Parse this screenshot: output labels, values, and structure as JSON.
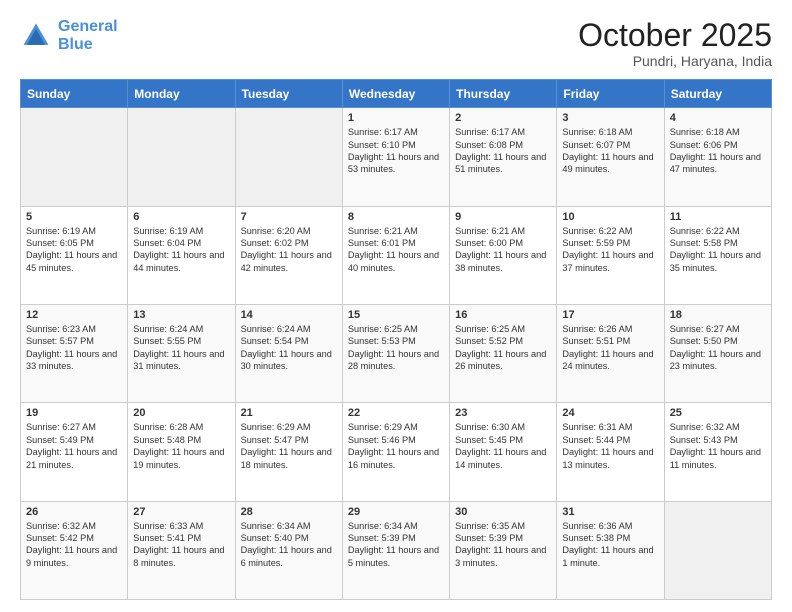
{
  "header": {
    "logo_line1": "General",
    "logo_line2": "Blue",
    "month": "October 2025",
    "location": "Pundri, Haryana, India"
  },
  "weekdays": [
    "Sunday",
    "Monday",
    "Tuesday",
    "Wednesday",
    "Thursday",
    "Friday",
    "Saturday"
  ],
  "weeks": [
    [
      {
        "day": "",
        "text": ""
      },
      {
        "day": "",
        "text": ""
      },
      {
        "day": "",
        "text": ""
      },
      {
        "day": "1",
        "text": "Sunrise: 6:17 AM\nSunset: 6:10 PM\nDaylight: 11 hours and 53 minutes."
      },
      {
        "day": "2",
        "text": "Sunrise: 6:17 AM\nSunset: 6:08 PM\nDaylight: 11 hours and 51 minutes."
      },
      {
        "day": "3",
        "text": "Sunrise: 6:18 AM\nSunset: 6:07 PM\nDaylight: 11 hours and 49 minutes."
      },
      {
        "day": "4",
        "text": "Sunrise: 6:18 AM\nSunset: 6:06 PM\nDaylight: 11 hours and 47 minutes."
      }
    ],
    [
      {
        "day": "5",
        "text": "Sunrise: 6:19 AM\nSunset: 6:05 PM\nDaylight: 11 hours and 45 minutes."
      },
      {
        "day": "6",
        "text": "Sunrise: 6:19 AM\nSunset: 6:04 PM\nDaylight: 11 hours and 44 minutes."
      },
      {
        "day": "7",
        "text": "Sunrise: 6:20 AM\nSunset: 6:02 PM\nDaylight: 11 hours and 42 minutes."
      },
      {
        "day": "8",
        "text": "Sunrise: 6:21 AM\nSunset: 6:01 PM\nDaylight: 11 hours and 40 minutes."
      },
      {
        "day": "9",
        "text": "Sunrise: 6:21 AM\nSunset: 6:00 PM\nDaylight: 11 hours and 38 minutes."
      },
      {
        "day": "10",
        "text": "Sunrise: 6:22 AM\nSunset: 5:59 PM\nDaylight: 11 hours and 37 minutes."
      },
      {
        "day": "11",
        "text": "Sunrise: 6:22 AM\nSunset: 5:58 PM\nDaylight: 11 hours and 35 minutes."
      }
    ],
    [
      {
        "day": "12",
        "text": "Sunrise: 6:23 AM\nSunset: 5:57 PM\nDaylight: 11 hours and 33 minutes."
      },
      {
        "day": "13",
        "text": "Sunrise: 6:24 AM\nSunset: 5:55 PM\nDaylight: 11 hours and 31 minutes."
      },
      {
        "day": "14",
        "text": "Sunrise: 6:24 AM\nSunset: 5:54 PM\nDaylight: 11 hours and 30 minutes."
      },
      {
        "day": "15",
        "text": "Sunrise: 6:25 AM\nSunset: 5:53 PM\nDaylight: 11 hours and 28 minutes."
      },
      {
        "day": "16",
        "text": "Sunrise: 6:25 AM\nSunset: 5:52 PM\nDaylight: 11 hours and 26 minutes."
      },
      {
        "day": "17",
        "text": "Sunrise: 6:26 AM\nSunset: 5:51 PM\nDaylight: 11 hours and 24 minutes."
      },
      {
        "day": "18",
        "text": "Sunrise: 6:27 AM\nSunset: 5:50 PM\nDaylight: 11 hours and 23 minutes."
      }
    ],
    [
      {
        "day": "19",
        "text": "Sunrise: 6:27 AM\nSunset: 5:49 PM\nDaylight: 11 hours and 21 minutes."
      },
      {
        "day": "20",
        "text": "Sunrise: 6:28 AM\nSunset: 5:48 PM\nDaylight: 11 hours and 19 minutes."
      },
      {
        "day": "21",
        "text": "Sunrise: 6:29 AM\nSunset: 5:47 PM\nDaylight: 11 hours and 18 minutes."
      },
      {
        "day": "22",
        "text": "Sunrise: 6:29 AM\nSunset: 5:46 PM\nDaylight: 11 hours and 16 minutes."
      },
      {
        "day": "23",
        "text": "Sunrise: 6:30 AM\nSunset: 5:45 PM\nDaylight: 11 hours and 14 minutes."
      },
      {
        "day": "24",
        "text": "Sunrise: 6:31 AM\nSunset: 5:44 PM\nDaylight: 11 hours and 13 minutes."
      },
      {
        "day": "25",
        "text": "Sunrise: 6:32 AM\nSunset: 5:43 PM\nDaylight: 11 hours and 11 minutes."
      }
    ],
    [
      {
        "day": "26",
        "text": "Sunrise: 6:32 AM\nSunset: 5:42 PM\nDaylight: 11 hours and 9 minutes."
      },
      {
        "day": "27",
        "text": "Sunrise: 6:33 AM\nSunset: 5:41 PM\nDaylight: 11 hours and 8 minutes."
      },
      {
        "day": "28",
        "text": "Sunrise: 6:34 AM\nSunset: 5:40 PM\nDaylight: 11 hours and 6 minutes."
      },
      {
        "day": "29",
        "text": "Sunrise: 6:34 AM\nSunset: 5:39 PM\nDaylight: 11 hours and 5 minutes."
      },
      {
        "day": "30",
        "text": "Sunrise: 6:35 AM\nSunset: 5:39 PM\nDaylight: 11 hours and 3 minutes."
      },
      {
        "day": "31",
        "text": "Sunrise: 6:36 AM\nSunset: 5:38 PM\nDaylight: 11 hours and 1 minute."
      },
      {
        "day": "",
        "text": ""
      }
    ]
  ]
}
